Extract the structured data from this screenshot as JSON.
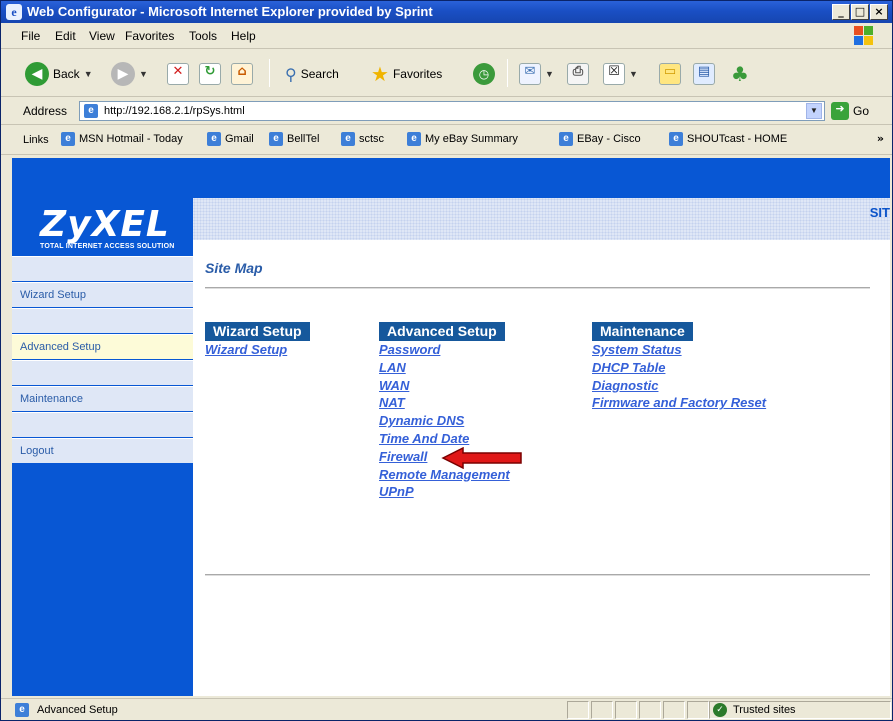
{
  "window": {
    "title": "Web Configurator - Microsoft Internet Explorer provided by Sprint",
    "controls": {
      "minimize": "_",
      "maximize": "□",
      "close": "×"
    }
  },
  "menu": [
    "File",
    "Edit",
    "View",
    "Favorites",
    "Tools",
    "Help"
  ],
  "toolbar": {
    "back": "Back",
    "search": "Search",
    "favorites": "Favorites"
  },
  "address": {
    "label": "Address",
    "url": "http://192.168.2.1/rpSys.html",
    "go": "Go"
  },
  "links": {
    "label": "Links",
    "items": [
      "MSN Hotmail - Today",
      "Gmail",
      "BellTel",
      "sctsc",
      "My eBay Summary",
      "EBay - Cisco",
      "SHOUTcast - HOME"
    ]
  },
  "page": {
    "logo": "ZyXEL",
    "logo_tagline": "Total Internet Access Solution",
    "header_right": "SIT",
    "title": "Site Map",
    "nav": [
      "Wizard Setup",
      "Advanced Setup",
      "Maintenance",
      "Logout"
    ],
    "active_nav": "Advanced Setup",
    "columns": [
      {
        "heading": "Wizard Setup",
        "links": [
          "Wizard Setup"
        ]
      },
      {
        "heading": "Advanced Setup",
        "links": [
          "Password",
          "LAN",
          "WAN",
          "NAT",
          "Dynamic DNS",
          "Time And Date",
          "Firewall",
          "Remote Management",
          "UPnP"
        ]
      },
      {
        "heading": "Maintenance",
        "links": [
          "System Status",
          "DHCP Table",
          "Diagnostic",
          "Firmware and Factory Reset"
        ]
      }
    ],
    "annotation": "red arrow pointing to Firewall"
  },
  "status": {
    "text": "Advanced Setup",
    "zone": "Trusted sites"
  },
  "colors": {
    "titlebar": "#1a4fc4",
    "router_blue": "#0857d4",
    "link": "#3560d8",
    "heading_bg": "#16589c",
    "nav_bg": "#dfe7f6",
    "nav_active": "#fdfbd8",
    "arrow": "#e01818"
  }
}
